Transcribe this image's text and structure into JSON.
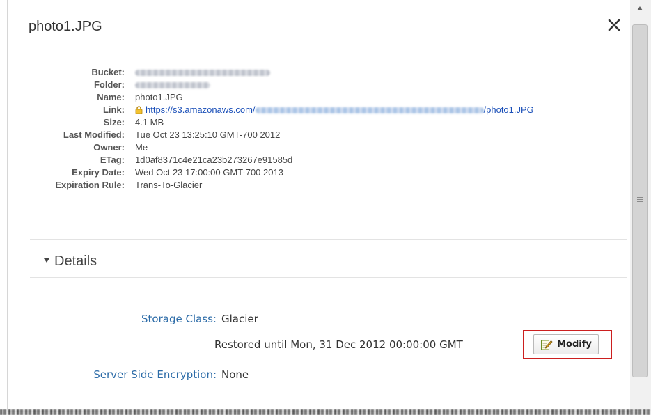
{
  "dialog": {
    "title": "photo1.JPG",
    "close_icon": "close-icon"
  },
  "properties": [
    {
      "label": "Bucket:",
      "value": ""
    },
    {
      "label": "Folder:",
      "value": ""
    },
    {
      "label": "Name:",
      "value": "photo1.JPG"
    },
    {
      "label": "Link:",
      "value_prefix": "https://s3.amazonaws.com/",
      "value_suffix": "/photo1.JPG"
    },
    {
      "label": "Size:",
      "value": "4.1 MB"
    },
    {
      "label": "Last Modified:",
      "value": "Tue Oct 23 13:25:10 GMT-700 2012"
    },
    {
      "label": "Owner:",
      "value": "Me"
    },
    {
      "label": "ETag:",
      "value": "1d0af8371c4e21ca23b273267e91585d"
    },
    {
      "label": "Expiry Date:",
      "value": "Wed Oct 23 17:00:00 GMT-700 2013"
    },
    {
      "label": "Expiration Rule:",
      "value": "Trans-To-Glacier"
    }
  ],
  "details": {
    "header": "Details",
    "storage_class_label": "Storage Class:",
    "storage_class_value": "Glacier",
    "restored_text": "Restored until Mon, 31 Dec 2012 00:00:00 GMT",
    "modify_label": "Modify",
    "encryption_label": "Server Side Encryption:",
    "encryption_value": "None"
  },
  "colors": {
    "link": "#1a4fb8",
    "detail_label": "#2d6ca8",
    "highlight": "#cc1f1f"
  }
}
